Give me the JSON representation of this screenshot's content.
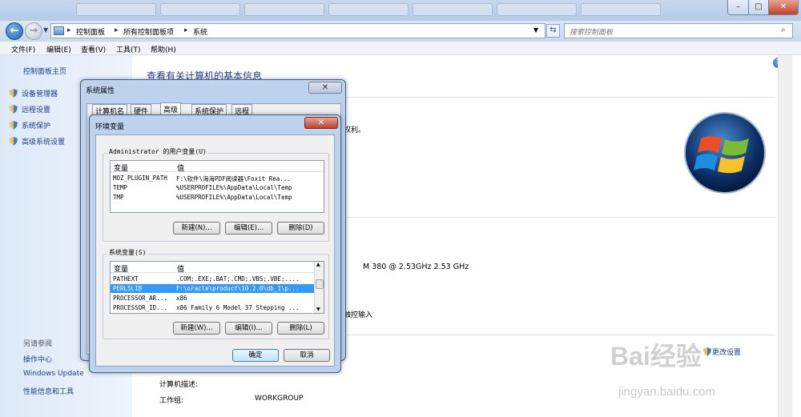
{
  "nav": {
    "breadcrumbs": [
      "控制面板",
      "所有控制面板项",
      "系统"
    ],
    "search_placeholder": "搜索控制面板"
  },
  "window_buttons": {
    "minimize": "–",
    "maximize": "□",
    "close": "✕"
  },
  "menu": [
    "文件(F)",
    "编辑(E)",
    "查看(V)",
    "工具(T)",
    "帮助(H)"
  ],
  "sidebar": {
    "home": "控制面板主页",
    "items": [
      "设备管理器",
      "远程设置",
      "系统保护",
      "高级系统设置"
    ],
    "see_also_title": "另请参阅",
    "see_also": [
      "操作中心",
      "Windows Update",
      "性能信息和工具"
    ]
  },
  "main": {
    "title": "查看有关计算机的基本信息",
    "rights_fragment": "权利。",
    "cpu_fragment": "M 380  @ 2.53GHz   2.53 GHz",
    "touch_fragment": "触控输入",
    "change_settings": "更改设置",
    "computer_desc_label": "计算机描述:",
    "workgroup_label": "工作组:",
    "workgroup_value": "WORKGROUP"
  },
  "sysprops": {
    "title": "系统属性",
    "tabs": [
      "计算机名",
      "硬件",
      "高级",
      "系统保护",
      "远程"
    ],
    "active_tab": "高级"
  },
  "envvars": {
    "title": "环境变量",
    "user_group_label": "Administrator 的用户变量(U)",
    "col_variable": "变量",
    "col_value": "值",
    "user_vars": [
      {
        "name": "MOZ_PLUGIN_PATH",
        "value": "F:\\软件\\海海PDF阅读器\\Foxit Rea..."
      },
      {
        "name": "TEMP",
        "value": "%USERPROFILE%\\AppData\\Local\\Temp"
      },
      {
        "name": "TMP",
        "value": "%USERPROFILE%\\AppData\\Local\\Temp"
      }
    ],
    "user_buttons": {
      "new": "新建(N)...",
      "edit": "编辑(E)...",
      "delete": "删除(D)"
    },
    "system_group_label": "系统变量(S)",
    "system_vars": [
      {
        "name": "PATHEXT",
        "value": ".COM;.EXE;.BAT;.CMD;.VBS;.VBE;...."
      },
      {
        "name": "PERL5LIB",
        "value": "F:\\oracle\\product\\10.2.0\\db_1\\p...",
        "selected": true
      },
      {
        "name": "PROCESSOR_AR...",
        "value": "x86"
      },
      {
        "name": "PROCESSOR_ID...",
        "value": "x86 Family 6 Model 37 Stepping ..."
      }
    ],
    "system_buttons": {
      "new": "新建(W)...",
      "edit": "编辑(I)...",
      "delete": "删除(L)"
    },
    "ok": "确定",
    "cancel": "取消"
  },
  "watermark": {
    "brand": "Bai经验",
    "url": "jingyan.baidu.com"
  },
  "colors": {
    "link": "#1e3c8c",
    "title_blue": "#1e3c8c",
    "selection": "#3399ff",
    "close_red": "#c0412b"
  }
}
